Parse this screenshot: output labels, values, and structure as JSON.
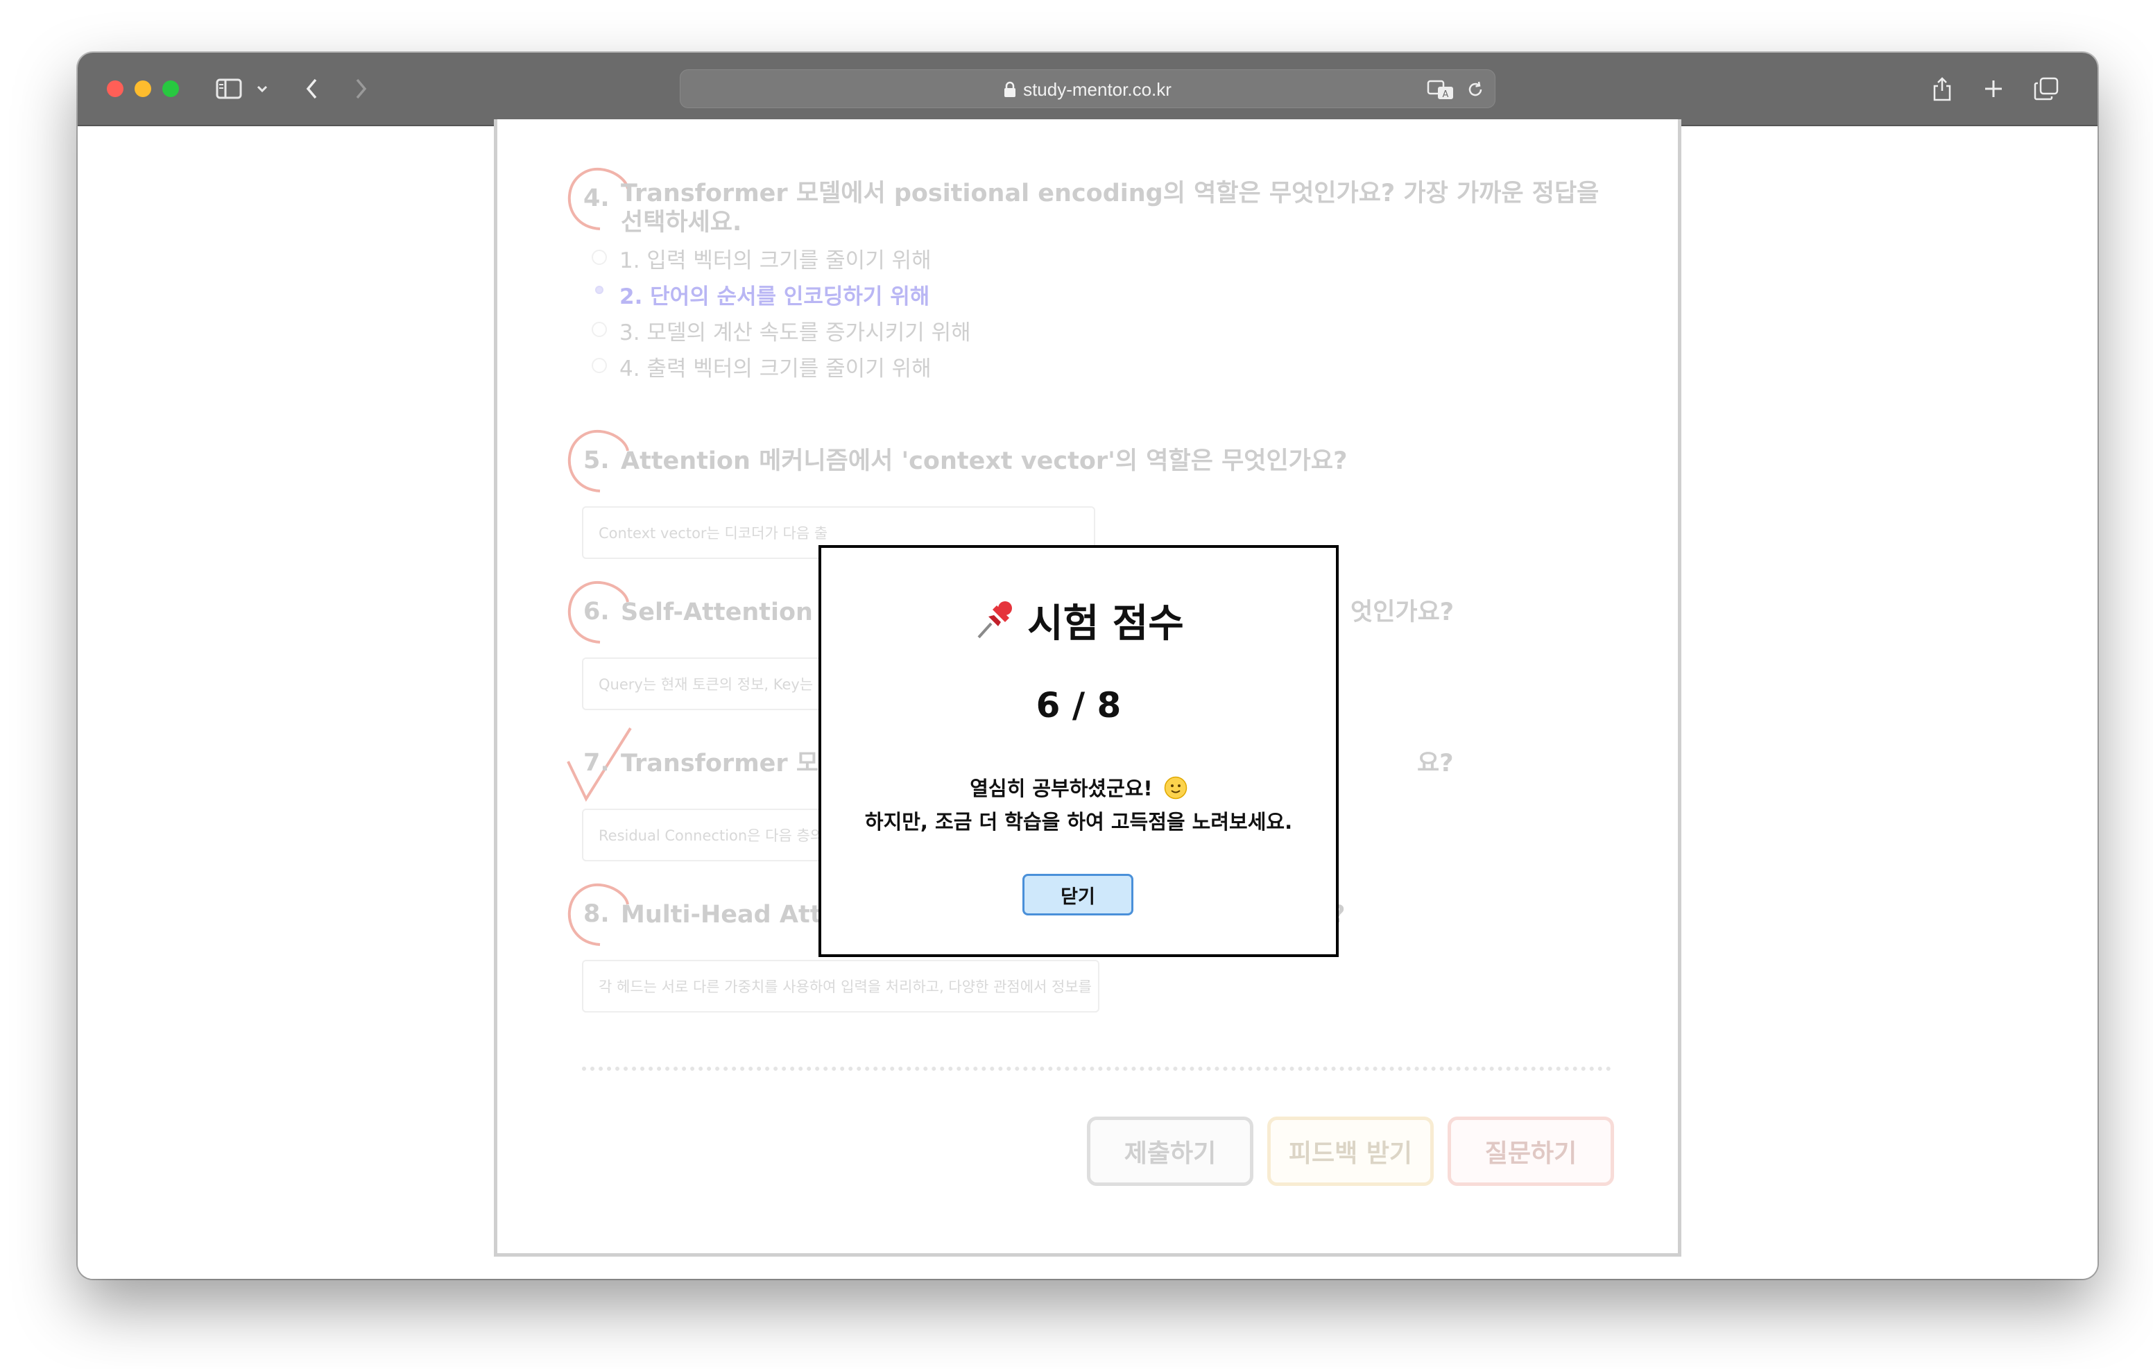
{
  "browser": {
    "url": "study-mentor.co.kr"
  },
  "questions": [
    {
      "number": "4.",
      "title": "Transformer 모델에서 positional encoding의 역할은 무엇인가요? 가장 가까운 정답을 선택하세요.",
      "options": [
        "1. 입력 벡터의 크기를 줄이기 위해",
        "2. 단어의 순서를 인코딩하기 위해",
        "3. 모델의 계산 속도를 증가시키기 위해",
        "4. 출력 벡터의 크기를 줄이기 위해"
      ],
      "selected_index": 1,
      "mark": "correct"
    },
    {
      "number": "5.",
      "title": "Attention 메커니즘에서 'context vector'의 역할은 무엇인가요?",
      "answer": "Context vector는 디코더가 다음 출",
      "mark": "correct"
    },
    {
      "number": "6.",
      "title_left": "Self-Attention 메",
      "title_right": "엇인가요?",
      "answer": "Query는 현재 토큰의 정보, Key는 주",
      "mark": "correct"
    },
    {
      "number": "7.",
      "title_left": "Transformer 모델",
      "title_right": "요?",
      "answer": "Residual Connection은 다음 층의",
      "mark": "wrong"
    },
    {
      "number": "8.",
      "title": "Multi-Head Attention에서 각 헤드는 어떻게 다르게 동작하나요?",
      "answer": "각 헤드는 서로 다른 가중치를 사용하여 입력을 처리하고, 다양한 관점에서 정보를",
      "mark": "correct"
    }
  ],
  "buttons": {
    "submit": "제출하기",
    "feedback": "피드백 받기",
    "question": "질문하기"
  },
  "modal": {
    "pin_icon": "pushpin-icon",
    "title": "시험 점수",
    "score": "6 / 8",
    "message_line1": "열심히 공부하셨군요!",
    "message_line2": "하지만, 조금 더 학습을 하여 고득점을 노려보세요.",
    "emoji": "slightly-smiling-face-icon",
    "close_label": "닫기"
  },
  "colors": {
    "toolbar": "#6b6b6b",
    "close_button_bg": "#cfe8fb",
    "close_button_border": "#4a90d9",
    "selected_option": "#b9b6f4",
    "mark": "#f1b3aa"
  }
}
